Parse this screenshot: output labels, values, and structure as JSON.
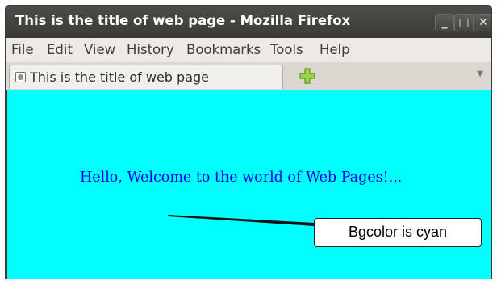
{
  "window": {
    "title": "This is the title of web page - Mozilla Firefox"
  },
  "window_controls": {
    "minimize": "_",
    "maximize": "□",
    "close": "✕"
  },
  "menu": [
    {
      "label": "File"
    },
    {
      "label": "Edit"
    },
    {
      "label": "View"
    },
    {
      "label": "History"
    },
    {
      "label": "Bookmarks"
    },
    {
      "label": "Tools"
    },
    {
      "label": "Help"
    }
  ],
  "tab": {
    "label": "This is the title of web page",
    "active": true
  },
  "tab_list_icon": "▼",
  "content": {
    "background": "#00ffff",
    "greeting": "Hello, Welcome to the world of Web Pages!..."
  },
  "annotation": {
    "text": "Bgcolor is cyan"
  }
}
